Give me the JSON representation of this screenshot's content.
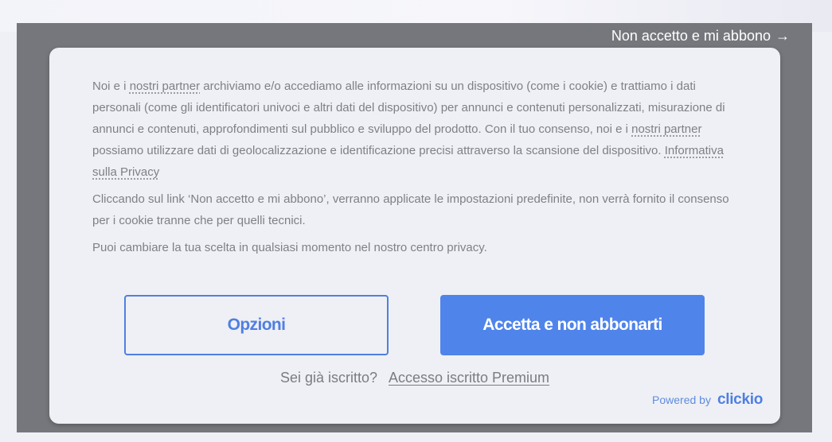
{
  "topbar": {
    "reject_label": "Non accetto e mi abbono",
    "reject_arrow": "→"
  },
  "consent": {
    "p1": {
      "part1": "Noi e i ",
      "link1": "nostri partner",
      "part2": " archiviamo e/o accediamo alle informazioni su un dispositivo (come i cookie) e trattiamo i dati personali (come gli identificatori univoci e altri dati del dispositivo) per annunci e contenuti personalizzati, misurazione di annunci e contenuti, approfondimenti sul pubblico e sviluppo del prodotto. Con il tuo consenso, noi e i ",
      "link2": "nostri partner",
      "part3": " possiamo utilizzare dati di geolocalizzazione e identificazione precisi attraverso la scansione del dispositivo. ",
      "link3": "Informativa sulla Privacy"
    },
    "p2": "Cliccando sul link ‘Non accetto e mi abbono’, verranno applicate le impostazioni predefinite, non verrà fornito il consenso per i cookie tranne che per quelli tecnici.",
    "p3": "Puoi cambiare la tua scelta in qualsiasi momento nel nostro centro privacy."
  },
  "buttons": {
    "options": "Opzioni",
    "accept": "Accetta e non abbonarti"
  },
  "login": {
    "question": "Sei già iscritto?",
    "link": "Accesso iscritto Premium"
  },
  "powered": {
    "label": "Powered by",
    "brand": "clickio"
  },
  "colors": {
    "accent": "#4f84ea",
    "overlay": "#76777c",
    "dialog_bg": "#eff0f5"
  }
}
